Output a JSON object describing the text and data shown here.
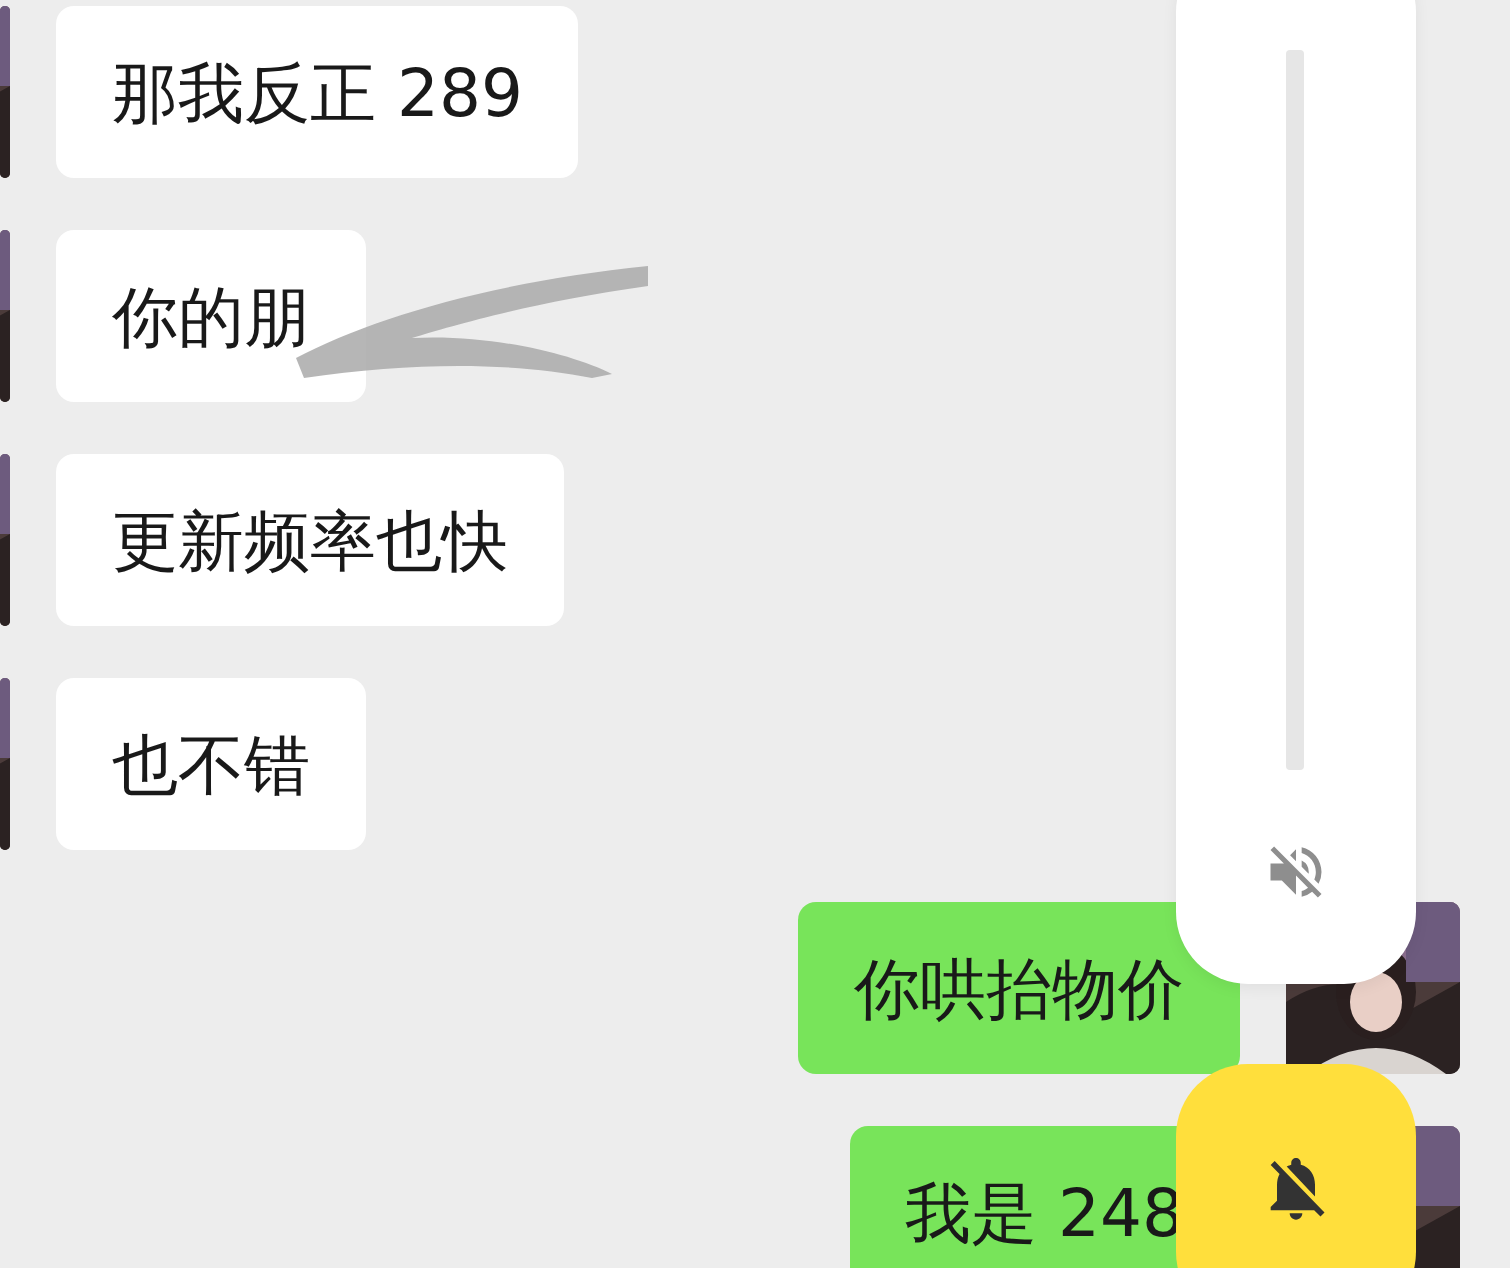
{
  "messages": [
    {
      "kind": "incoming",
      "text": "那我反正 289",
      "scribbled": false
    },
    {
      "kind": "incoming",
      "text": "你的朋",
      "scribbled": true
    },
    {
      "kind": "incoming",
      "text": "更新频率也快",
      "scribbled": false
    },
    {
      "kind": "incoming",
      "text": "也不错",
      "scribbled": false
    },
    {
      "kind": "outgoing",
      "text": "你哄抬物价",
      "scribbled": false
    },
    {
      "kind": "outgoing",
      "text": "我是 248",
      "scribbled": false
    }
  ],
  "volume": {
    "muted": true
  },
  "notifications": {
    "muted": true
  }
}
